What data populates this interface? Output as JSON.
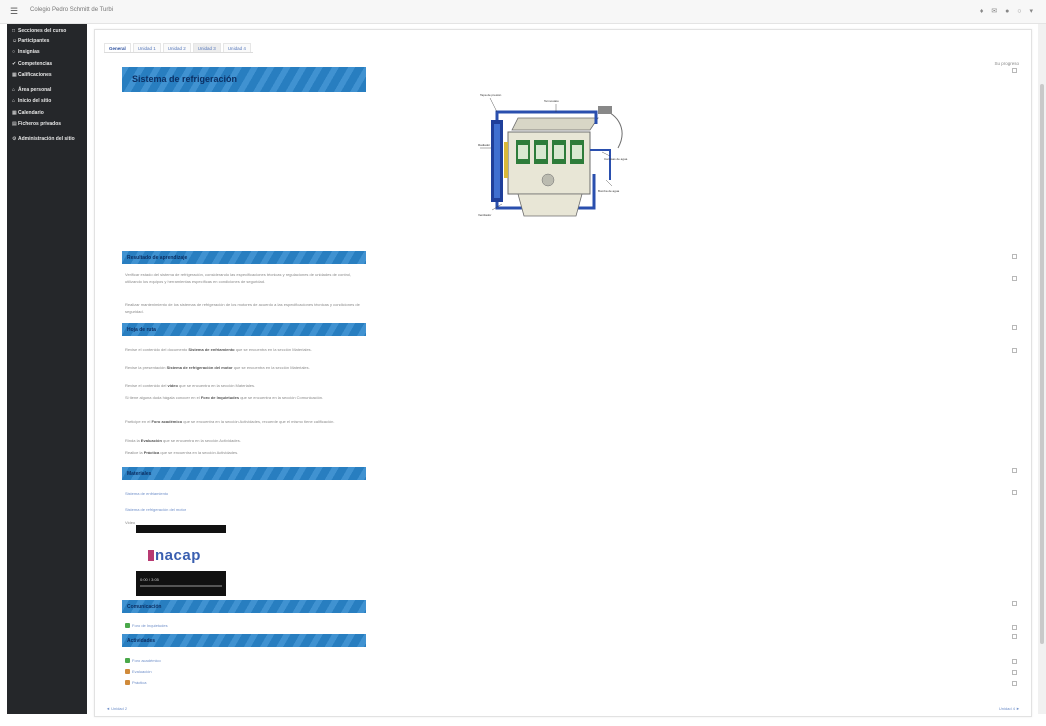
{
  "topbar": {
    "menu_icon": "hamburger-icon",
    "site_name": "Colegio Pedro Schmitt de Turbi",
    "tools": "♦ ✉ ● ○ ▾"
  },
  "sidebar": {
    "items": [
      {
        "icon": "□",
        "label": "Secciones del curso"
      },
      {
        "icon": "☺",
        "label": "Participantes"
      },
      {
        "icon": "○",
        "label": "Insignias"
      },
      {
        "icon": "✔",
        "label": "Competencias"
      },
      {
        "icon": "▦",
        "label": "Calificaciones"
      },
      {
        "icon": "⌂",
        "label": "Área personal"
      },
      {
        "icon": "⌂",
        "label": "Inicio del sitio"
      },
      {
        "icon": "▦",
        "label": "Calendario"
      },
      {
        "icon": "▤",
        "label": "Ficheros privados"
      },
      {
        "icon": "⚙",
        "label": "Administración del sitio"
      }
    ]
  },
  "tabs": [
    {
      "label": "General"
    },
    {
      "label": "Unidad 1"
    },
    {
      "label": "Unidad 2"
    },
    {
      "label": "Unidad 3"
    },
    {
      "label": "Unidad 4"
    }
  ],
  "progress_label": "Su progreso",
  "main": {
    "title": "Sistema de refrigeración",
    "sections": {
      "resultado": {
        "title": "Resultado de aprendizaje",
        "p1": "Verificar estado del sistema de refrigeración, considerando las especificaciones técnicas y regulaciones de unidades de control, utilizando los equipos y herramientas específicas en condiciones de seguridad.",
        "p2": "Realizar mantenimiento de los sistemas de refrigeración de los motores de acuerdo a las especificaciones técnicas y condiciones de seguridad."
      },
      "ruta": {
        "title": "Hoja de ruta",
        "lines": [
          {
            "pre": "Revise el contenido del documento ",
            "bold": "Sistema de enfriamiento",
            "post": " que se encuentra en la sección Materiales."
          },
          {
            "pre": "Revise la presentación ",
            "bold": "Sistema de refrigeración del motor",
            "post": " que se encuentra en la sección Materiales."
          },
          {
            "pre": "Revise el contenido del ",
            "bold": "video",
            "post": " que se encuentra en la sección Materiales."
          },
          {
            "pre": "Si tiene alguna duda hágala conocer en el ",
            "bold": "Foro de Inquietudes",
            "post": " que se encuentra en la sección Comunicación."
          },
          {
            "pre": "Participe en el ",
            "bold": "Foro académico",
            "post": " que se encuentra en la sección Actividades, recuerde que el mismo tiene calificación."
          },
          {
            "pre": "Rinda la ",
            "bold": "Evaluación",
            "post": " que se encuentra en la sección Actividades."
          },
          {
            "pre": "Realice la ",
            "bold": "Práctica",
            "post": " que se encuentra en la sección Actividades."
          }
        ]
      },
      "materiales": {
        "title": "Materiales",
        "link1": "Sistema de enfriamiento",
        "link2": "Sistema de refrigeración del motor",
        "video_label": "Video",
        "video_logo": "nacap",
        "video_time": "0:00 / 3:05"
      },
      "comunicacion": {
        "title": "Comunicación",
        "forum": "Foro de Inquietudes"
      },
      "actividades": {
        "title": "Actividades",
        "items": [
          "Foro académico",
          "Evaluación",
          "Práctica"
        ]
      }
    }
  },
  "engine_labels": {
    "l1": "Tapa de presión",
    "l2": "Termostato",
    "l3": "Radiador",
    "l4": "Ventilador",
    "l5": "Bomba de agua",
    "l6": "Camisas de agua"
  },
  "footer": {
    "prev": "◄ Unidad 2",
    "next": "Unidad 4 ►"
  },
  "colors": {
    "banner": "#2a86cc",
    "sidebar": "#25272a",
    "link": "#6f8fc9"
  }
}
